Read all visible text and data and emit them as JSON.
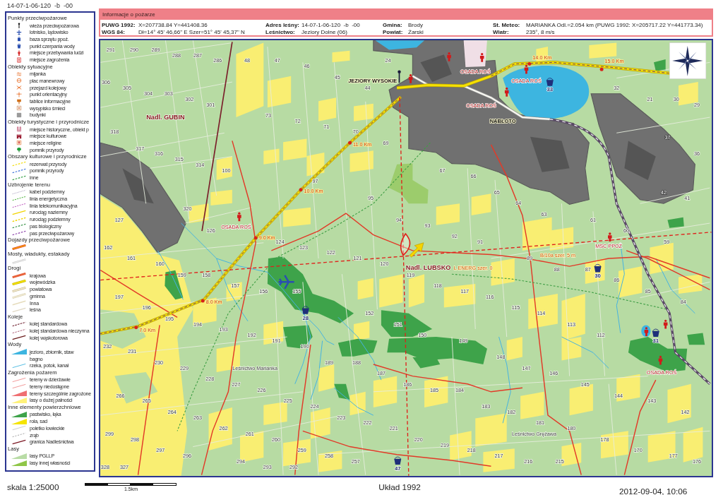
{
  "doc_code": "14-07-1-06-120  -b  -00",
  "legend": {
    "sections": [
      {
        "title": "Punkty przeciwpożarowe",
        "items": [
          {
            "label": "wieża przeciwpożarowa",
            "kind": "point"
          },
          {
            "label": "lotnisko, lądowisko",
            "kind": "point"
          },
          {
            "label": "baza sprzętu ppoż.",
            "kind": "point"
          },
          {
            "label": "punkt czerpania wody",
            "kind": "point"
          },
          {
            "label": "miejsce przebywania ludzi",
            "kind": "point"
          },
          {
            "label": "miejsce zagrożenia",
            "kind": "point"
          }
        ]
      },
      {
        "title": "Obiekty sytuacyjne",
        "items": [
          {
            "label": "mijanka",
            "kind": "point"
          },
          {
            "label": "plac manewrowy",
            "kind": "point"
          },
          {
            "label": "przejazd kolejowy",
            "kind": "point"
          },
          {
            "label": "punkt orientacyjny",
            "kind": "point"
          },
          {
            "label": "tablice informacyjne",
            "kind": "point"
          },
          {
            "label": "wysypisko śmieci",
            "kind": "point"
          },
          {
            "label": "budynki",
            "kind": "point"
          }
        ]
      },
      {
        "title": "Obiekty turystyczne i przyrodnicze",
        "items": [
          {
            "label": "miejsce historyczne, obiekt p",
            "kind": "point"
          },
          {
            "label": "miejsce kulturowe",
            "kind": "point"
          },
          {
            "label": "miejsce religine",
            "kind": "point"
          },
          {
            "label": "pomnik przyrody",
            "kind": "point"
          }
        ]
      },
      {
        "title": "Obszary kulturowe i przyrodnicze",
        "items": [
          {
            "label": "rezerwat przyrody",
            "kind": "line"
          },
          {
            "label": "pomnik przyrody",
            "kind": "line"
          },
          {
            "label": "inne",
            "kind": "line"
          }
        ]
      },
      {
        "title": "Uzbrojenie terenu",
        "items": [
          {
            "label": "kabel podziemny",
            "kind": "line"
          },
          {
            "label": "linia energetyczna",
            "kind": "line"
          },
          {
            "label": "linia telekomunikacyjna",
            "kind": "line"
          },
          {
            "label": "rurociąg naziemny",
            "kind": "line"
          },
          {
            "label": "rurociąg podziemny",
            "kind": "line"
          },
          {
            "label": "pas biologiczny",
            "kind": "line"
          },
          {
            "label": "pas przeciwpożarowy",
            "kind": "line"
          }
        ]
      },
      {
        "title": "Dojazdy przeciwpożarowe",
        "items": [
          {
            "kind": "line"
          }
        ]
      },
      {
        "title": "Mosty, wiadukty, estakady",
        "items": [
          {
            "kind": "line"
          }
        ]
      },
      {
        "title": "Drogi",
        "items": [
          {
            "label": "krajowa",
            "kind": "line"
          },
          {
            "label": "wojewódzka",
            "kind": "line"
          },
          {
            "label": "powiatowa",
            "kind": "line"
          },
          {
            "label": "gminna",
            "kind": "line"
          },
          {
            "label": "Inna",
            "kind": "line"
          },
          {
            "label": "leśna",
            "kind": "line"
          }
        ]
      },
      {
        "title": "Koleje",
        "items": [
          {
            "label": "kolej standardowa",
            "kind": "line"
          },
          {
            "label": "kolej standardowa nieczynna",
            "kind": "line"
          },
          {
            "label": "kolej wąskotorowa",
            "kind": "line"
          }
        ]
      },
      {
        "title": "Wody",
        "items": [
          {
            "label": "jezioro, zbiornik, staw",
            "kind": "area"
          },
          {
            "label": "bagno",
            "kind": "none"
          },
          {
            "label": "rzeka, potok, kanał",
            "kind": "line"
          }
        ]
      },
      {
        "title": "Zagrożenia pożarem",
        "items": [
          {
            "label": "tereny w dzierżawie",
            "kind": "line"
          },
          {
            "label": "tereny niedostępne",
            "kind": "line"
          },
          {
            "label": "tereny szczególnie zagrożone",
            "kind": "area"
          },
          {
            "label": "lasy o dużej palności",
            "kind": "area"
          }
        ]
      },
      {
        "title": "Inne elementy powierzchniowe",
        "items": [
          {
            "label": "pastwisko, łąka",
            "kind": "area"
          },
          {
            "label": "rola, sad",
            "kind": "area"
          },
          {
            "label": "poletko łowieckie",
            "kind": "line"
          },
          {
            "label": "zrąb",
            "kind": "line"
          },
          {
            "label": "granica Nadleśnictwa",
            "kind": "line"
          }
        ]
      },
      {
        "title": "Lasy",
        "items": [
          {
            "label": "lasy PGLLP",
            "kind": "area"
          },
          {
            "label": "lasy innej własności",
            "kind": "area"
          }
        ]
      }
    ]
  },
  "fire_info": {
    "title": "Informacje o pożarze",
    "fields": [
      {
        "label": "PUWG 1992:",
        "value": "X=207738.84 Y=441408.36"
      },
      {
        "label": "Adres leśny:",
        "value": "14-07-1-06-120  -b  -00"
      },
      {
        "label": "Gmina:",
        "value": "Brody"
      },
      {
        "label": "St. Meteo:",
        "value": "MARIANKA Odl.=2.054 km (PUWG 1992: X=205717.22 Y=441773.34)"
      },
      {
        "label": "WGS 84:",
        "value": "Dł=14° 45' 46,66\" E Szer=51° 45' 45,37\" N"
      },
      {
        "label": "Leśnictwo:",
        "value": "Jeziory Dolne (06)"
      },
      {
        "label": "Powiat:",
        "value": "Żarski"
      },
      {
        "label": "Wiatr:",
        "value": "235°, 8 m/s"
      }
    ]
  },
  "map": {
    "labels": [
      {
        "kind": "km",
        "text": "14.0 Km"
      },
      {
        "kind": "km",
        "text": "15.0 Km"
      },
      {
        "kind": "rescue",
        "text": "OSADA ROŚ"
      },
      {
        "kind": "settlement",
        "text": "JEZIORY WYSOKIE"
      },
      {
        "kind": "rescue",
        "text": "OSADA ROŚ"
      },
      {
        "kind": "water",
        "text": "33"
      },
      {
        "kind": "rescue",
        "text": "OSADA ROŚ"
      },
      {
        "kind": "district",
        "text": "Nadl. GUBIN"
      },
      {
        "kind": "settlement",
        "text": "NABŁOTO"
      },
      {
        "kind": "km",
        "text": "11.0 Km"
      },
      {
        "kind": "km",
        "text": "10.0 Km"
      },
      {
        "kind": "rescue",
        "text": "OSADA ROŚ"
      },
      {
        "kind": "km",
        "text": "9.0 Km"
      },
      {
        "kind": "station",
        "text": "MSC PPOŻ"
      },
      {
        "kind": "route",
        "text": "B/10a szer. 5 m"
      },
      {
        "kind": "district",
        "text": "Nadl. LUBSKO"
      },
      {
        "kind": "route",
        "text": "L ENERG szer. 0"
      },
      {
        "kind": "water",
        "text": "30"
      },
      {
        "kind": "km",
        "text": "8.0 Km"
      },
      {
        "kind": "water",
        "text": "28"
      },
      {
        "kind": "km",
        "text": "7.0 Km"
      },
      {
        "kind": "water",
        "text": "31"
      },
      {
        "kind": "forestry",
        "text": "Leśnictwo Marianka"
      },
      {
        "kind": "rescue",
        "text": "OSADA ROŚ"
      },
      {
        "kind": "forestry",
        "text": "Leśnictwo Grężawa"
      },
      {
        "kind": "water",
        "text": "47"
      }
    ],
    "parcel_numbers": [
      "291",
      "290",
      "289",
      "288",
      "287",
      "286",
      "48",
      "47",
      "24",
      "46",
      "45",
      "306",
      "305",
      "44",
      "32",
      "304",
      "303",
      "302",
      "21",
      "30",
      "301",
      "29",
      "73",
      "72",
      "71",
      "318",
      "70",
      "37",
      "69",
      "317",
      "316",
      "36",
      "315",
      "314",
      "100",
      "67",
      "66",
      "97",
      "65",
      "42",
      "95",
      "41",
      "64",
      "320",
      "63",
      "127",
      "94",
      "61",
      "93",
      "126",
      "60",
      "92",
      "124",
      "91",
      "59",
      "162",
      "123",
      "122",
      "161",
      "121",
      "89",
      "160",
      "120",
      "88",
      "87",
      "159",
      "158",
      "119",
      "86",
      "157",
      "118",
      "156",
      "155",
      "117",
      "85",
      "197",
      "116",
      "84",
      "196",
      "115",
      "152",
      "114",
      "195",
      "194",
      "151",
      "113",
      "193",
      "192",
      "150",
      "112",
      "191",
      "149",
      "232",
      "190",
      "231",
      "148",
      "230",
      "189",
      "188",
      "229",
      "147",
      "187",
      "146",
      "228",
      "227",
      "186",
      "145",
      "226",
      "185",
      "184",
      "266",
      "144",
      "265",
      "225",
      "143",
      "224",
      "183",
      "264",
      "182",
      "142",
      "263",
      "223",
      "222",
      "181",
      "262",
      "221",
      "180",
      "299",
      "261",
      "298",
      "260",
      "220",
      "178",
      "219",
      "297",
      "259",
      "218",
      "170",
      "296",
      "258",
      "217",
      "177",
      "294",
      "257",
      "216",
      "215",
      "176",
      "328",
      "327",
      "293",
      "292"
    ]
  },
  "footer": {
    "scale": "skala 1:25000",
    "scale_bar_label": "1.5km",
    "coordinate_system": "Układ 1992",
    "timestamp": "2012-09-04, 10:06"
  }
}
